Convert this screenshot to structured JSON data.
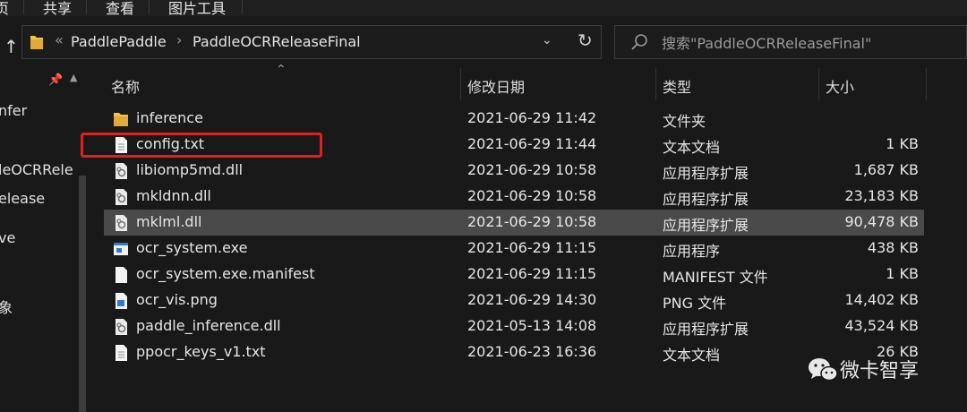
{
  "ribbon": {
    "tabs": [
      {
        "label": "页"
      },
      {
        "label": "共享"
      },
      {
        "label": "查看"
      },
      {
        "label": "图片工具"
      }
    ]
  },
  "address": {
    "overflow": "«",
    "crumbs": [
      "PaddlePaddle",
      "PaddleOCRReleaseFinal"
    ],
    "separator": "›"
  },
  "search": {
    "placeholder": "搜索\"PaddleOCRReleaseFinal\""
  },
  "nav": {
    "items": [
      "nfer",
      "leOCRRele",
      "elease",
      "ve",
      "象"
    ]
  },
  "columns": {
    "name": "名称",
    "modified": "修改日期",
    "type": "类型",
    "size": "大小"
  },
  "files": [
    {
      "name": "inference",
      "modified": "2021-06-29 11:42",
      "type": "文件夹",
      "size": "",
      "icon": "folder-icon"
    },
    {
      "name": "config.txt",
      "modified": "2021-06-29 11:44",
      "type": "文本文档",
      "size": "1 KB",
      "icon": "text-file-icon"
    },
    {
      "name": "libiomp5md.dll",
      "modified": "2021-06-29 10:58",
      "type": "应用程序扩展",
      "size": "1,687 KB",
      "icon": "dll-file-icon"
    },
    {
      "name": "mkldnn.dll",
      "modified": "2021-06-29 10:58",
      "type": "应用程序扩展",
      "size": "23,183 KB",
      "icon": "dll-file-icon"
    },
    {
      "name": "mklml.dll",
      "modified": "2021-06-29 10:58",
      "type": "应用程序扩展",
      "size": "90,478 KB",
      "icon": "dll-file-icon",
      "selected": true
    },
    {
      "name": "ocr_system.exe",
      "modified": "2021-06-29 11:15",
      "type": "应用程序",
      "size": "438 KB",
      "icon": "exe-file-icon"
    },
    {
      "name": "ocr_system.exe.manifest",
      "modified": "2021-06-29 11:15",
      "type": "MANIFEST 文件",
      "size": "1 KB",
      "icon": "blank-file-icon"
    },
    {
      "name": "ocr_vis.png",
      "modified": "2021-06-29 14:30",
      "type": "PNG 文件",
      "size": "14,402 KB",
      "icon": "image-file-icon"
    },
    {
      "name": "paddle_inference.dll",
      "modified": "2021-05-13 14:08",
      "type": "应用程序扩展",
      "size": "43,524 KB",
      "icon": "dll-file-icon"
    },
    {
      "name": "ppocr_keys_v1.txt",
      "modified": "2021-06-23 16:36",
      "type": "文本文档",
      "size": "26 KB",
      "icon": "text-file-icon"
    }
  ],
  "watermark": {
    "text": "微卡智享",
    "icon": "wechat-icon"
  },
  "colors": {
    "background": "#191919",
    "selected_row": "#4a4a4a",
    "highlight": "#e0201b",
    "folder": "#f2c14e"
  }
}
